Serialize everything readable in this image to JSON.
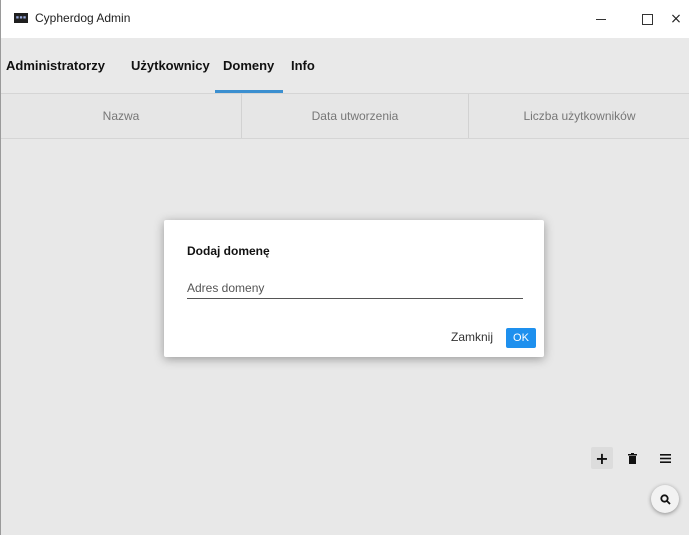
{
  "window": {
    "title": "Cypherdog Admin",
    "close_symbol": "×"
  },
  "tabs": [
    {
      "label": "Administratorzy"
    },
    {
      "label": "Użytkownicy"
    },
    {
      "label": "Domeny",
      "active": true
    },
    {
      "label": "Info"
    }
  ],
  "table": {
    "columns": [
      "Nazwa",
      "Data utworzenia",
      "Liczba użytkowników"
    ],
    "rows": []
  },
  "dialog": {
    "title": "Dodaj domenę",
    "input_placeholder": "Adres domeny",
    "input_value": "",
    "close_label": "Zamknij",
    "ok_label": "OK"
  },
  "toolbar": {
    "icons": [
      "plus-icon",
      "trash-icon",
      "menu-icon"
    ]
  },
  "search_fab": {
    "icon": "search-icon"
  },
  "colors": {
    "accent": "#1e90ee",
    "tab_underline": "#3b8fd0"
  }
}
